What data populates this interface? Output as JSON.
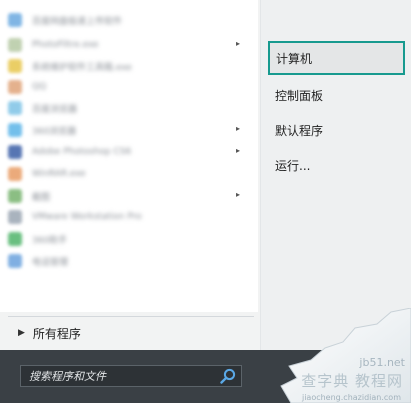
{
  "program_list": {
    "items": [
      {
        "label": "百度网盘极速上传软件",
        "icon_color": "#6aa9e0",
        "has_submenu": false
      },
      {
        "label": "PhotoFiltre.exe",
        "icon_color": "#b6c9a4",
        "has_submenu": true
      },
      {
        "label": "系统维护软件工具箱.exe",
        "icon_color": "#e7c64b",
        "has_submenu": false
      },
      {
        "label": "QQ",
        "icon_color": "#e0a47a",
        "has_submenu": false
      },
      {
        "label": "百度浏览器",
        "icon_color": "#7ec3e6",
        "has_submenu": false
      },
      {
        "label": "360浏览器",
        "icon_color": "#5bb4e8",
        "has_submenu": true
      },
      {
        "label": "Adobe Photoshop CS6",
        "icon_color": "#3a5ea6",
        "has_submenu": true
      },
      {
        "label": "WinRAR.exe",
        "icon_color": "#e89c64",
        "has_submenu": false
      },
      {
        "label": "截图",
        "icon_color": "#77b36e",
        "has_submenu": true
      },
      {
        "label": "VMware Workstation Pro",
        "icon_color": "#9ba6b3",
        "has_submenu": false
      },
      {
        "label": "360助手",
        "icon_color": "#4fb46a",
        "has_submenu": false
      },
      {
        "label": "电话管理",
        "icon_color": "#6aa2dd",
        "has_submenu": false
      }
    ],
    "all_programs_label": "所有程序"
  },
  "right_panel": {
    "items": [
      {
        "label": "计算机",
        "highlighted": true
      },
      {
        "label": "控制面板",
        "highlighted": false
      },
      {
        "label": "默认程序",
        "highlighted": false
      },
      {
        "label": "运行...",
        "highlighted": false
      }
    ]
  },
  "search": {
    "placeholder": "搜索程序和文件",
    "value": ""
  },
  "watermark": {
    "site": "jb51.net",
    "cn": "查字典 教程网",
    "url": "jiaocheng.chazidian.com"
  },
  "colors": {
    "highlight_border": "#179a8f",
    "search_bar_bg": "#3a4045",
    "right_panel_bg": "#eef0f1"
  }
}
